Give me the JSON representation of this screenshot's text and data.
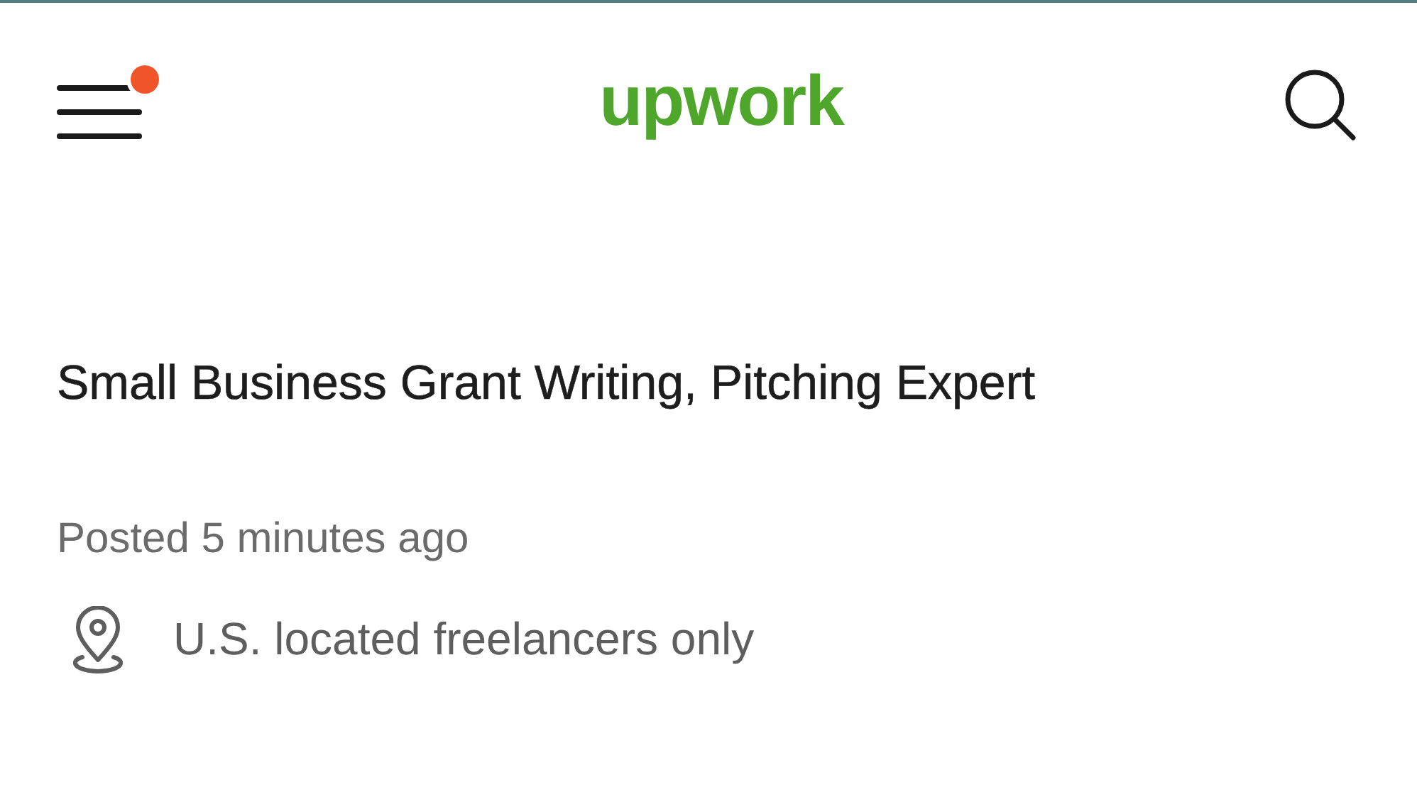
{
  "header": {
    "logo": "upwork",
    "menu": {
      "has_notification": true
    }
  },
  "job": {
    "title": "Small Business Grant Writing, Pitching Expert",
    "posted": "Posted 5 minutes ago",
    "location": "U.S. located freelancers only"
  }
}
